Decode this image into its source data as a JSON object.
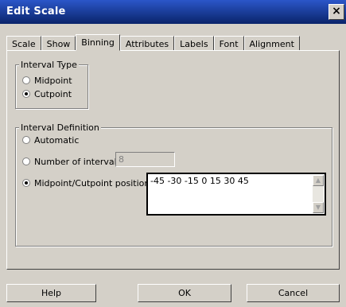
{
  "window": {
    "title": "Edit Scale",
    "close_icon": "×"
  },
  "tabs": [
    {
      "label": "Scale",
      "active": false
    },
    {
      "label": "Show",
      "active": false
    },
    {
      "label": "Binning",
      "active": true
    },
    {
      "label": "Attributes",
      "active": false
    },
    {
      "label": "Labels",
      "active": false
    },
    {
      "label": "Font",
      "active": false
    },
    {
      "label": "Alignment",
      "active": false
    }
  ],
  "interval_type": {
    "title": "Interval Type",
    "options": [
      {
        "label": "Midpoint",
        "checked": false
      },
      {
        "label": "Cutpoint",
        "checked": true
      }
    ]
  },
  "interval_definition": {
    "title": "Interval Definition",
    "automatic_label": "Automatic",
    "number_label": "Number of intervals:",
    "number_value": "8",
    "positions_label": "Midpoint/Cutpoint positions:",
    "positions_value": "-45 -30 -15 0 15 30 45",
    "selected": "positions"
  },
  "buttons": {
    "help": "Help",
    "ok": "OK",
    "cancel": "Cancel"
  },
  "icons": {
    "scroll_up": "up-arrow",
    "scroll_down": "down-arrow"
  }
}
